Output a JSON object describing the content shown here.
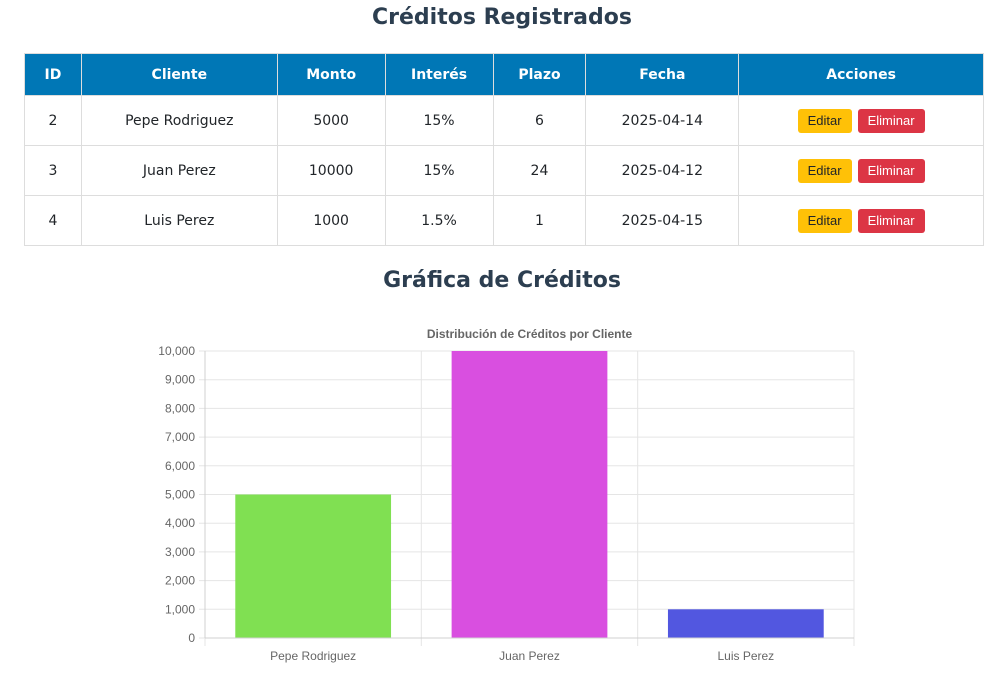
{
  "titles": {
    "registrados": "Créditos Registrados",
    "grafica": "Gráfica de Créditos"
  },
  "table": {
    "headers": [
      "ID",
      "Cliente",
      "Monto",
      "Interés",
      "Plazo",
      "Fecha",
      "Acciones"
    ],
    "rows": [
      {
        "id": "2",
        "cliente": "Pepe Rodriguez",
        "monto": "5000",
        "interes": "15%",
        "plazo": "6",
        "fecha": "2025-04-14"
      },
      {
        "id": "3",
        "cliente": "Juan Perez",
        "monto": "10000",
        "interes": "15%",
        "plazo": "24",
        "fecha": "2025-04-12"
      },
      {
        "id": "4",
        "cliente": "Luis Perez",
        "monto": "1000",
        "interes": "1.5%",
        "plazo": "1",
        "fecha": "2025-04-15"
      }
    ],
    "edit_label": "Editar",
    "delete_label": "Eliminar"
  },
  "colors": {
    "header_bg": "#0077b6",
    "edit_bg": "#ffc107",
    "delete_bg": "#dc3545",
    "bars": [
      "#80e052",
      "#d94fe0",
      "#5257e0"
    ]
  },
  "chart_data": {
    "type": "bar",
    "title": "Distribución de Créditos por Cliente",
    "categories": [
      "Pepe Rodriguez",
      "Juan Perez",
      "Luis Perez"
    ],
    "values": [
      5000,
      10000,
      1000
    ],
    "ylim": [
      0,
      10000
    ],
    "yticks": [
      "0",
      "1,000",
      "2,000",
      "3,000",
      "4,000",
      "5,000",
      "6,000",
      "7,000",
      "8,000",
      "9,000",
      "10,000"
    ],
    "grid": true,
    "legend": "none"
  }
}
